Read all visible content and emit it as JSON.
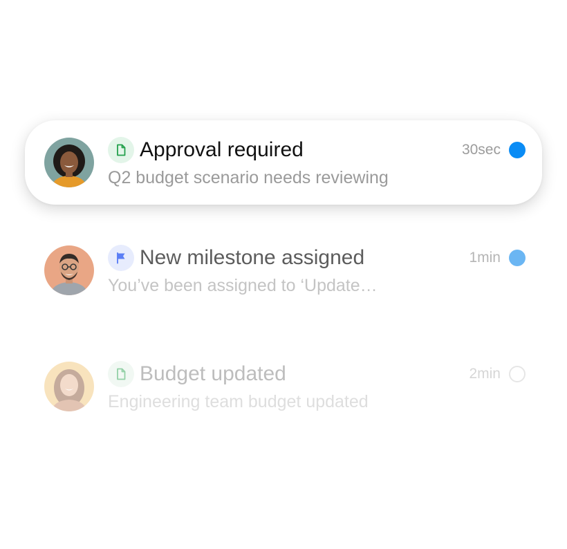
{
  "notifications": [
    {
      "title": "Approval required",
      "body": "Q2 budget scenario needs reviewing",
      "time": "30sec",
      "type_icon": "document-icon",
      "type_color": "#22a04b",
      "status": "unread",
      "status_color": "#0a8cf5"
    },
    {
      "title": "New milestone assigned",
      "body": "You’ve been assigned to ‘Update…",
      "time": "1min",
      "type_icon": "flag-icon",
      "type_color": "#5b7ef5",
      "status": "unread",
      "status_color": "#6bb6f3"
    },
    {
      "title": "Budget updated",
      "body": "Engineering team budget updated",
      "time": "2min",
      "type_icon": "document-icon",
      "type_color": "#22a04b",
      "status": "read",
      "status_color": "#e6e6e6"
    }
  ]
}
